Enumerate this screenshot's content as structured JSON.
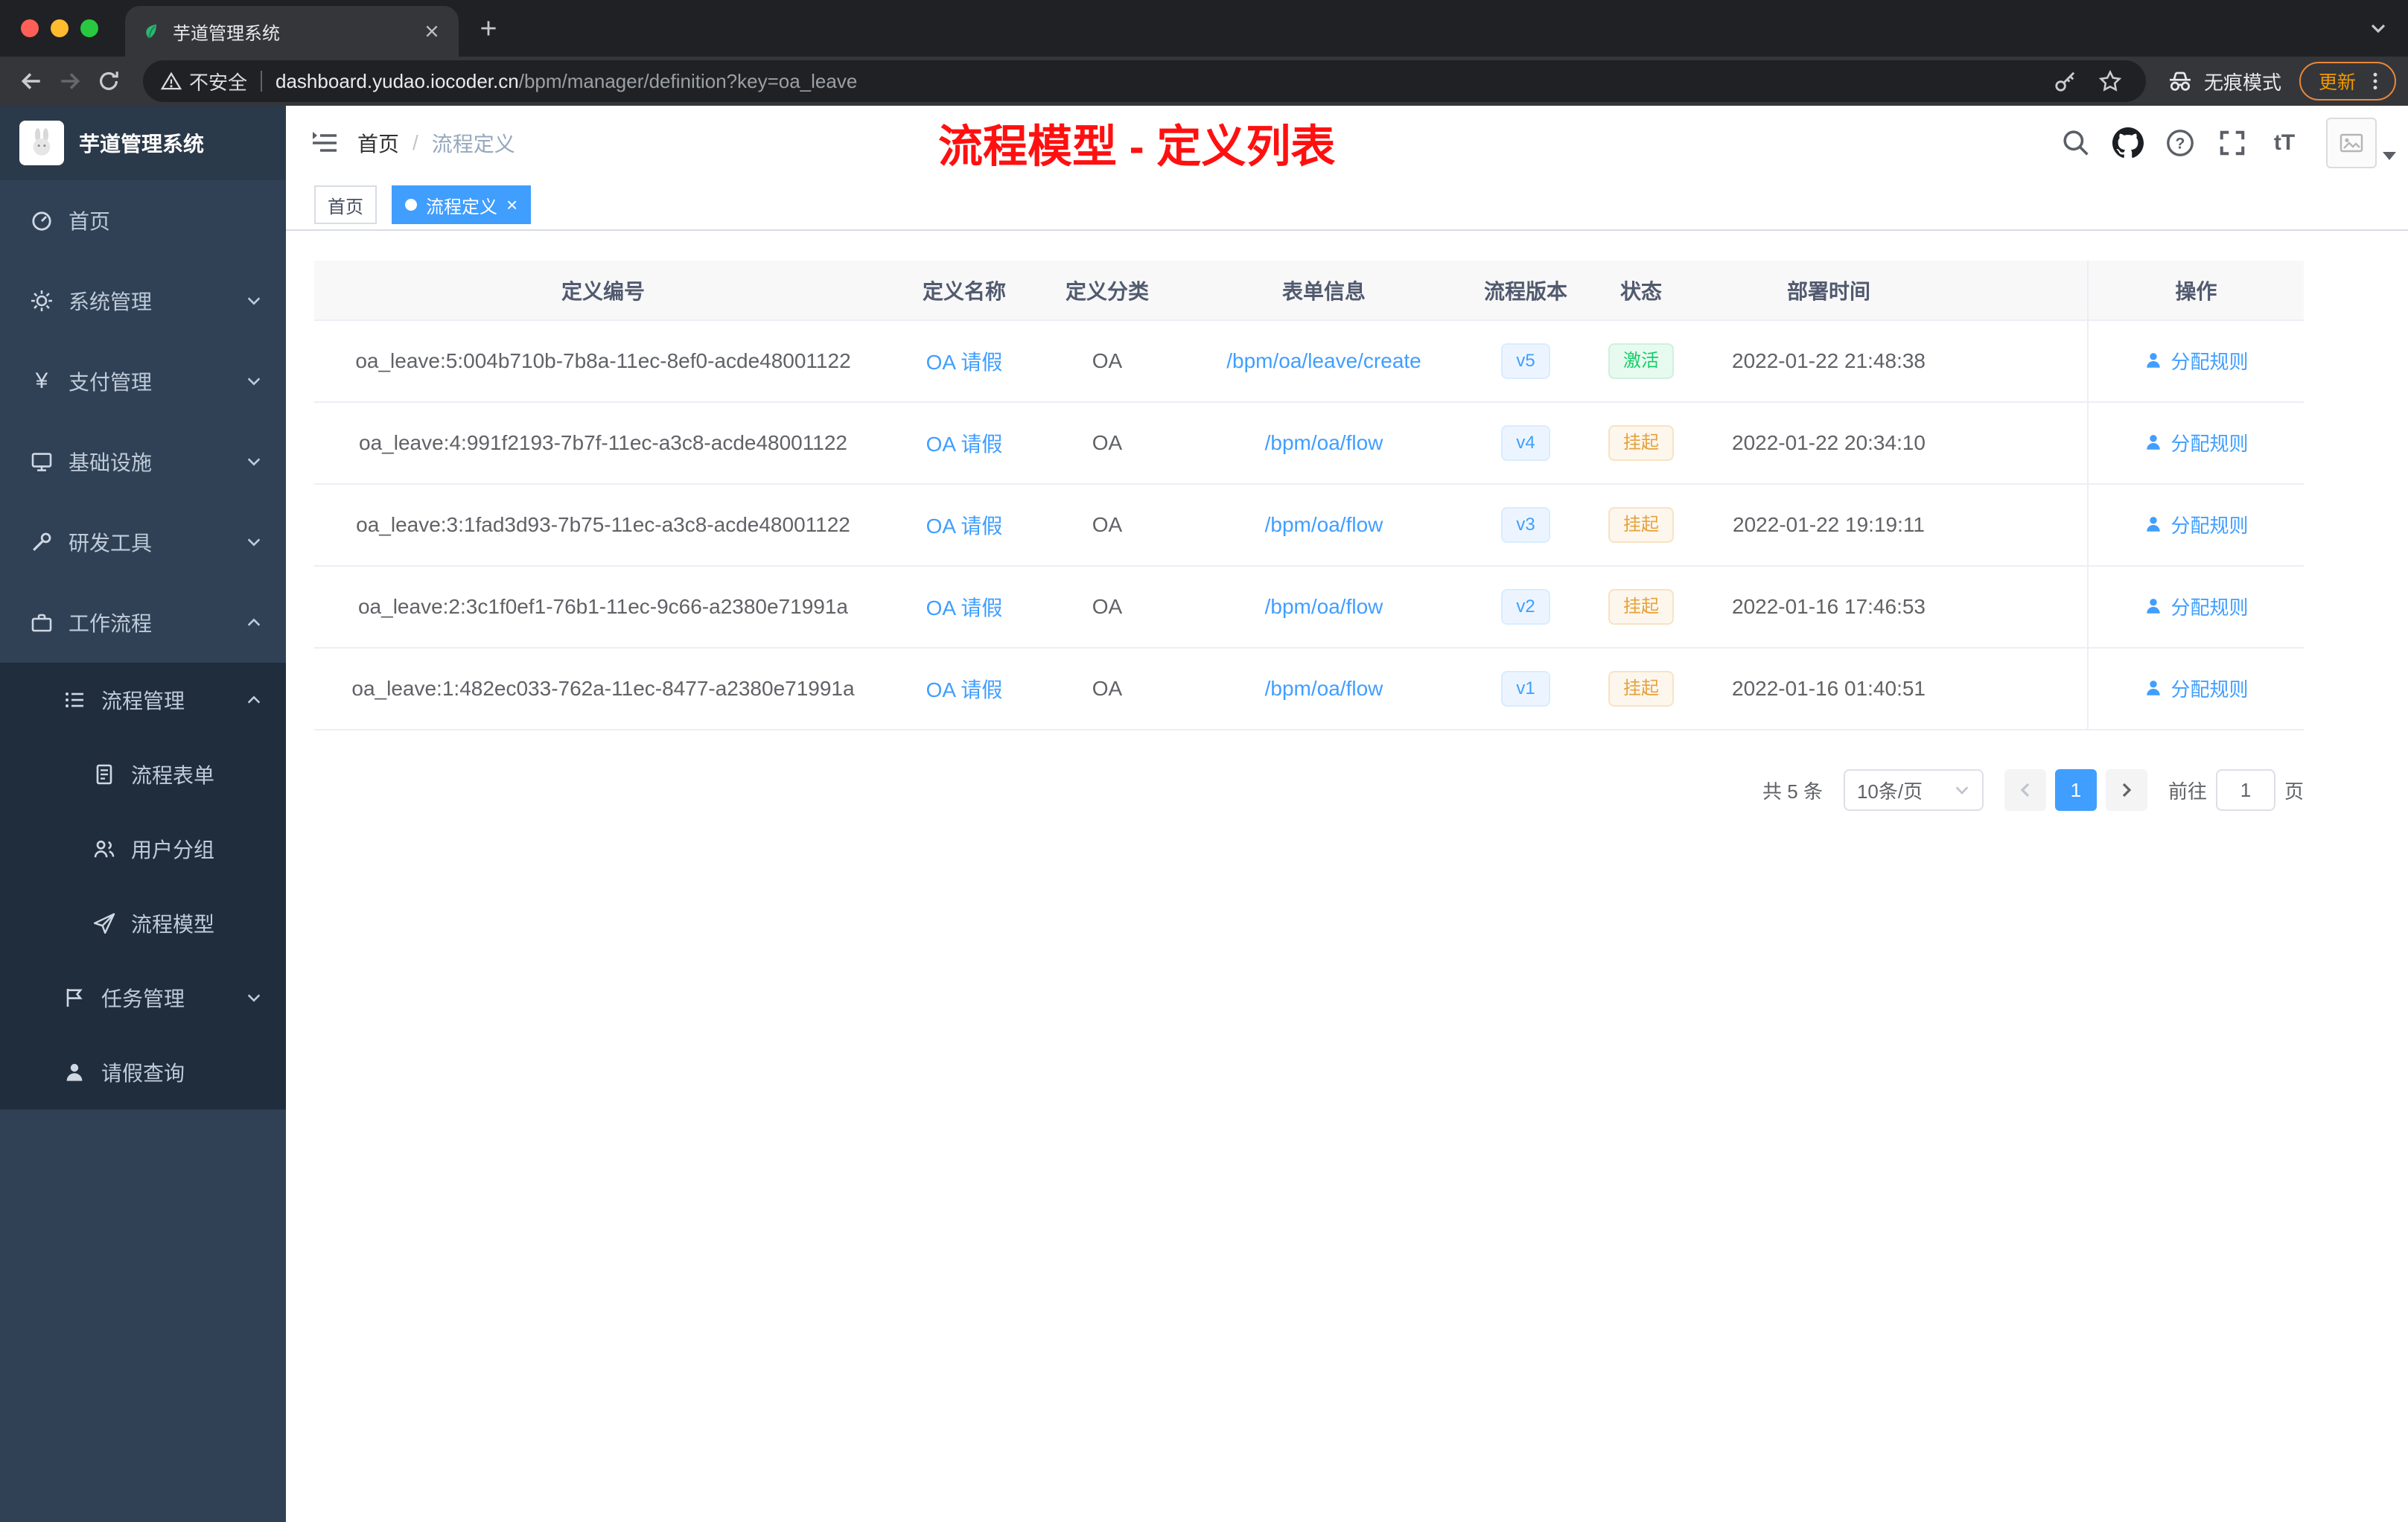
{
  "browser": {
    "tab_title": "芋道管理系统",
    "security_label": "不安全",
    "url_host": "dashboard.yudao.iocoder.cn",
    "url_path": "/bpm/manager/definition?key=oa_leave",
    "incognito_label": "无痕模式",
    "update_label": "更新"
  },
  "sidebar": {
    "app_title": "芋道管理系统",
    "items": [
      {
        "label": "首页",
        "icon": "dashboard-icon",
        "level": 0
      },
      {
        "label": "系统管理",
        "icon": "gear-icon",
        "level": 0,
        "chevron": "down"
      },
      {
        "label": "支付管理",
        "icon": "yen-icon",
        "level": 0,
        "chevron": "down"
      },
      {
        "label": "基础设施",
        "icon": "monitor-icon",
        "level": 0,
        "chevron": "down"
      },
      {
        "label": "研发工具",
        "icon": "wrench-icon",
        "level": 0,
        "chevron": "down"
      },
      {
        "label": "工作流程",
        "icon": "briefcase-icon",
        "level": 0,
        "chevron": "up"
      },
      {
        "label": "流程管理",
        "icon": "list-icon",
        "level": 1,
        "chevron": "up"
      },
      {
        "label": "流程表单",
        "icon": "document-icon",
        "level": 2
      },
      {
        "label": "用户分组",
        "icon": "user-group-icon",
        "level": 2
      },
      {
        "label": "流程模型",
        "icon": "paper-plane-icon",
        "level": 2
      },
      {
        "label": "任务管理",
        "icon": "flag-icon",
        "level": 1,
        "chevron": "down"
      },
      {
        "label": "请假查询",
        "icon": "user-icon",
        "level": 1
      }
    ]
  },
  "header": {
    "breadcrumb_home": "首页",
    "breadcrumb_separator": "/",
    "breadcrumb_current": "流程定义",
    "annotation": "流程模型 - 定义列表"
  },
  "tags_bar": [
    {
      "label": "首页",
      "active": false
    },
    {
      "label": "流程定义",
      "active": true,
      "closable": true
    }
  ],
  "table": {
    "columns": [
      "定义编号",
      "定义名称",
      "定义分类",
      "表单信息",
      "流程版本",
      "状态",
      "部署时间",
      "操作"
    ],
    "rows": [
      {
        "id": "oa_leave:5:004b710b-7b8a-11ec-8ef0-acde48001122",
        "name": "OA 请假",
        "category": "OA",
        "form": "/bpm/oa/leave/create",
        "version": "v5",
        "status": "激活",
        "status_type": "success",
        "deploy_time": "2022-01-22 21:48:38",
        "action": "分配规则"
      },
      {
        "id": "oa_leave:4:991f2193-7b7f-11ec-a3c8-acde48001122",
        "name": "OA 请假",
        "category": "OA",
        "form": "/bpm/oa/flow",
        "version": "v4",
        "status": "挂起",
        "status_type": "warning",
        "deploy_time": "2022-01-22 20:34:10",
        "action": "分配规则"
      },
      {
        "id": "oa_leave:3:1fad3d93-7b75-11ec-a3c8-acde48001122",
        "name": "OA 请假",
        "category": "OA",
        "form": "/bpm/oa/flow",
        "version": "v3",
        "status": "挂起",
        "status_type": "warning",
        "deploy_time": "2022-01-22 19:19:11",
        "action": "分配规则"
      },
      {
        "id": "oa_leave:2:3c1f0ef1-76b1-11ec-9c66-a2380e71991a",
        "name": "OA 请假",
        "category": "OA",
        "form": "/bpm/oa/flow",
        "version": "v2",
        "status": "挂起",
        "status_type": "warning",
        "deploy_time": "2022-01-16 17:46:53",
        "action": "分配规则"
      },
      {
        "id": "oa_leave:1:482ec033-762a-11ec-8477-a2380e71991a",
        "name": "OA 请假",
        "category": "OA",
        "form": "/bpm/oa/flow",
        "version": "v1",
        "status": "挂起",
        "status_type": "warning",
        "deploy_time": "2022-01-16 01:40:51",
        "action": "分配规则"
      }
    ]
  },
  "pagination": {
    "total_label": "共 5 条",
    "page_size": "10条/页",
    "current_page": "1",
    "goto_label": "前往",
    "goto_page": "1",
    "page_unit": "页"
  },
  "icons": {
    "favicon": "green-sprout",
    "search-icon": "magnifier",
    "github-icon": "octocat",
    "help-icon": "question-circle",
    "fullscreen-icon": "corner-brackets",
    "font-size-icon": "tT",
    "assign-rule-icon": "user-silhouette",
    "incognito-icon": "spy-glasses"
  },
  "colors": {
    "accent_blue": "#409eff",
    "success_green": "#13ce66",
    "warning_orange": "#e6a23c",
    "annotation_red": "#ff1010",
    "sidebar_bg": "#304156",
    "sidebar_submenu_bg": "#1f2d3d",
    "header_row_bg": "#f8f8f9",
    "browser_dark": "#202124",
    "update_orange": "#f29900"
  }
}
